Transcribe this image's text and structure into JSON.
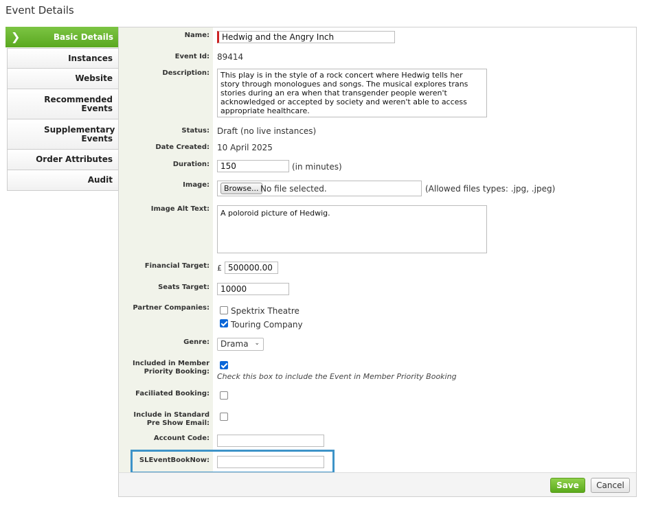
{
  "page": {
    "title": "Event Details"
  },
  "nav": {
    "active": "Basic Details",
    "items": [
      "Instances",
      "Website",
      "Recommended Events",
      "Supplementary Events",
      "Order Attributes",
      "Audit"
    ]
  },
  "form": {
    "name": {
      "label": "Name:",
      "value": "Hedwig and the Angry Inch"
    },
    "event_id": {
      "label": "Event Id:",
      "value": "89414"
    },
    "description": {
      "label": "Description:",
      "value": "This play is in the style of a rock concert where Hedwig tells her story through monologues and songs. The musical explores trans stories during an era when that transgender people weren't acknowledged or accepted by society and weren't able to access appropriate healthcare."
    },
    "status": {
      "label": "Status:",
      "value": "Draft (no live instances)"
    },
    "date_created": {
      "label": "Date Created:",
      "value": "10 April 2025"
    },
    "duration": {
      "label": "Duration:",
      "value": "150",
      "unit": "(in minutes)"
    },
    "image": {
      "label": "Image:",
      "browse": "Browse...",
      "file_status": "No file selected.",
      "allowed": "(Allowed files types: .jpg, .jpeg)"
    },
    "image_alt": {
      "label": "Image Alt Text:",
      "value": "A poloroid picture of Hedwig."
    },
    "financial_target": {
      "label": "Financial Target:",
      "currency": "£",
      "value": "500000.00"
    },
    "seats_target": {
      "label": "Seats Target:",
      "value": "10000"
    },
    "partner_companies": {
      "label": "Partner Companies:",
      "options": [
        {
          "name": "Spektrix Theatre",
          "checked": false
        },
        {
          "name": "Touring Company",
          "checked": true
        }
      ]
    },
    "genre": {
      "label": "Genre:",
      "value": "Drama"
    },
    "member_priority": {
      "label_line1": "Included in Member",
      "label_line2": "Priority Booking:",
      "checked": true,
      "hint": "Check this box to include the Event in Member Priority Booking"
    },
    "facilitated": {
      "label": "Faciliated Booking:",
      "checked": false
    },
    "pre_show_email": {
      "label_line1": "Include in Standard",
      "label_line2": "Pre Show Email:",
      "checked": false
    },
    "account_code": {
      "label": "Account Code:",
      "value": ""
    },
    "sl_event_book_now": {
      "label": "SLEventBookNow:",
      "value": ""
    }
  },
  "footer": {
    "save": "Save",
    "cancel": "Cancel"
  },
  "colors": {
    "accent": "#5aa820",
    "highlight": "#3d93c8",
    "checkbox": "#0a66d8"
  }
}
